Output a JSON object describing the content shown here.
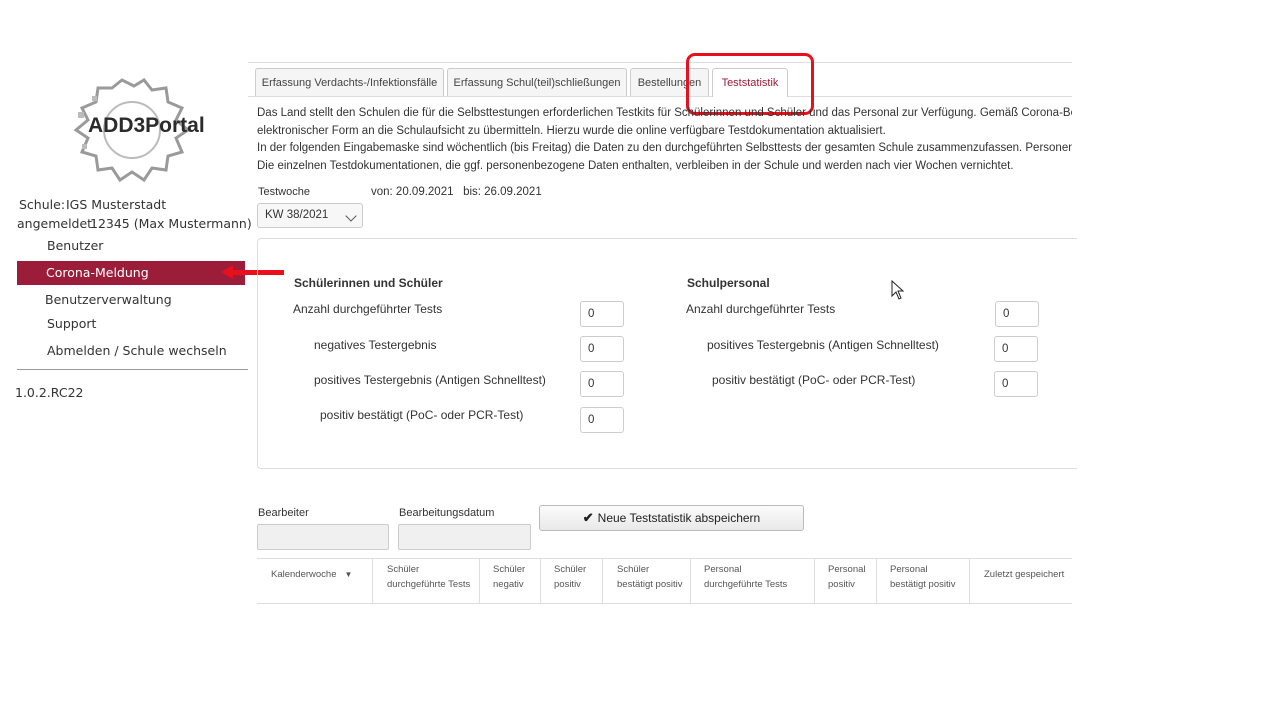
{
  "logo": {
    "text": "ADD3Portal"
  },
  "school": {
    "label": "Schule:",
    "name": "IGS Musterstadt",
    "logged_in_label": "angemeldet:",
    "user": "12345  (Max Mustermann)"
  },
  "sidebar": {
    "items": [
      {
        "label": "Benutzer"
      },
      {
        "label": "Corona-Meldung"
      },
      {
        "label": "Benutzerverwaltung"
      },
      {
        "label": "Support"
      },
      {
        "label": "Abmelden / Schule wechseln"
      }
    ],
    "version": "1.0.2.RC22"
  },
  "tabs": [
    {
      "label": "Erfassung Verdachts-/Infektionsfälle"
    },
    {
      "label": "Erfassung Schul(teil)schließungen"
    },
    {
      "label": "Bestellungen"
    },
    {
      "label": "Teststatistik"
    }
  ],
  "intro": {
    "lines": [
      "Das Land stellt den Schulen die für die Selbsttestungen erforderlichen Testkits für Schülerinnen und Schüler und das Personal zur Verfügung. Gemäß Corona-Be",
      "elektronischer Form an die Schulaufsicht zu übermitteln. Hierzu wurde die online verfügbare Testdokumentation aktualisiert.",
      "In der folgenden Eingabemaske sind wöchentlich (bis Freitag) die Daten zu den durchgeführten Selbsttests der gesamten Schule zusammenzufassen. Personen",
      "Die einzelnen Testdokumentationen, die ggf. personenbezogene Daten enthalten, verbleiben in der Schule und werden nach vier Wochen vernichtet."
    ]
  },
  "testwoche": {
    "label": "Testwoche",
    "range": "von: 20.09.2021   bis: 26.09.2021",
    "selected": "KW 38/2021"
  },
  "students": {
    "title": "Schülerinnen und Schüler",
    "fields": [
      {
        "label": "Anzahl durchgeführter Tests",
        "value": "0"
      },
      {
        "label": "negatives Testergebnis",
        "value": "0"
      },
      {
        "label": "positives Testergebnis (Antigen Schnelltest)",
        "value": "0"
      },
      {
        "label": "positiv bestätigt (PoC- oder PCR-Test)",
        "value": "0"
      }
    ]
  },
  "staff": {
    "title": "Schulpersonal",
    "fields": [
      {
        "label": "Anzahl durchgeführter Tests",
        "value": "0"
      },
      {
        "label": "positives Testergebnis (Antigen Schnelltest)",
        "value": "0"
      },
      {
        "label": "positiv bestätigt (PoC- oder PCR-Test)",
        "value": "0"
      }
    ]
  },
  "form": {
    "editor_label": "Bearbeiter",
    "date_label": "Bearbeitungsdatum",
    "save_label": "Neue Teststatistik abspeichern"
  },
  "table": {
    "columns": [
      {
        "line1": "Kalenderwoche",
        "line2": ""
      },
      {
        "line1": "Schüler",
        "line2": "durchgeführte Tests"
      },
      {
        "line1": "Schüler",
        "line2": "negativ"
      },
      {
        "line1": "Schüler",
        "line2": "positiv"
      },
      {
        "line1": "Schüler",
        "line2": "bestätigt positiv"
      },
      {
        "line1": "Personal",
        "line2": "durchgeführte Tests"
      },
      {
        "line1": "Personal",
        "line2": "positiv"
      },
      {
        "line1": "Personal",
        "line2": "bestätigt positiv"
      },
      {
        "line1": "Zuletzt gespeichert",
        "line2": ""
      }
    ]
  },
  "colors": {
    "accent": "#9b1d3a",
    "annotation": "#e8101c"
  }
}
